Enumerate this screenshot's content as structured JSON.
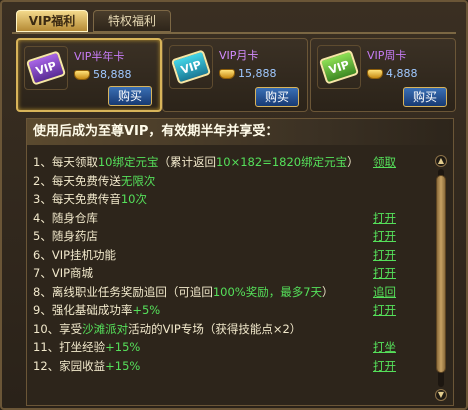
{
  "tabs": [
    {
      "label": "VIP福利",
      "active": true
    },
    {
      "label": "特权福利",
      "active": false
    }
  ],
  "cards": [
    {
      "title": "VIP半年卡",
      "price": "58,888",
      "buy": "购买",
      "icon": "vip-halfyear-ticket-icon"
    },
    {
      "title": "VIP月卡",
      "price": "15,888",
      "buy": "购买",
      "icon": "vip-month-ticket-icon"
    },
    {
      "title": "VIP周卡",
      "price": "4,888",
      "buy": "购买",
      "icon": "vip-week-ticket-icon"
    }
  ],
  "headline": "使用后成为至尊VIP，有效期半年并享受：",
  "benefits": [
    {
      "no": "1、",
      "parts": [
        [
          "每天领取",
          false
        ],
        [
          "10绑定元宝",
          true
        ],
        [
          "（累计返回",
          false
        ],
        [
          "10×182=1820绑定元宝",
          true
        ],
        [
          "）",
          false
        ]
      ],
      "action": "领取"
    },
    {
      "no": "2、",
      "parts": [
        [
          "每天免费传送",
          false
        ],
        [
          "无限次",
          true
        ]
      ],
      "action": ""
    },
    {
      "no": "3、",
      "parts": [
        [
          "每天免费传音",
          false
        ],
        [
          "10次",
          true
        ]
      ],
      "action": ""
    },
    {
      "no": "4、",
      "parts": [
        [
          "随身仓库",
          false
        ]
      ],
      "action": "打开"
    },
    {
      "no": "5、",
      "parts": [
        [
          "随身药店",
          false
        ]
      ],
      "action": "打开"
    },
    {
      "no": "6、",
      "parts": [
        [
          "VIP挂机功能",
          false
        ]
      ],
      "action": "打开"
    },
    {
      "no": "7、",
      "parts": [
        [
          "VIP商城",
          false
        ]
      ],
      "action": "打开"
    },
    {
      "no": "8、",
      "parts": [
        [
          "离线职业任务奖励追回（可追回",
          false
        ],
        [
          "100%奖励，最多7天",
          true
        ],
        [
          "）",
          false
        ]
      ],
      "action": "追回"
    },
    {
      "no": "9、",
      "parts": [
        [
          "强化基础成功率",
          false
        ],
        [
          "+5%",
          true
        ]
      ],
      "action": "打开"
    },
    {
      "no": "10、",
      "parts": [
        [
          "享受",
          false
        ],
        [
          "沙滩派对",
          true
        ],
        [
          "活动的VIP专场（获得技能点×2）",
          false
        ]
      ],
      "action": ""
    },
    {
      "no": "11、",
      "parts": [
        [
          "打坐经验",
          false
        ],
        [
          "+15%",
          true
        ]
      ],
      "action": "打坐"
    },
    {
      "no": "12、",
      "parts": [
        [
          "家园收益",
          false
        ],
        [
          "+15%",
          true
        ]
      ],
      "action": "打开"
    }
  ],
  "colors": {
    "accent": "#55e05a",
    "gold": "#d8b45a",
    "button_blue": "#1f4f95"
  }
}
